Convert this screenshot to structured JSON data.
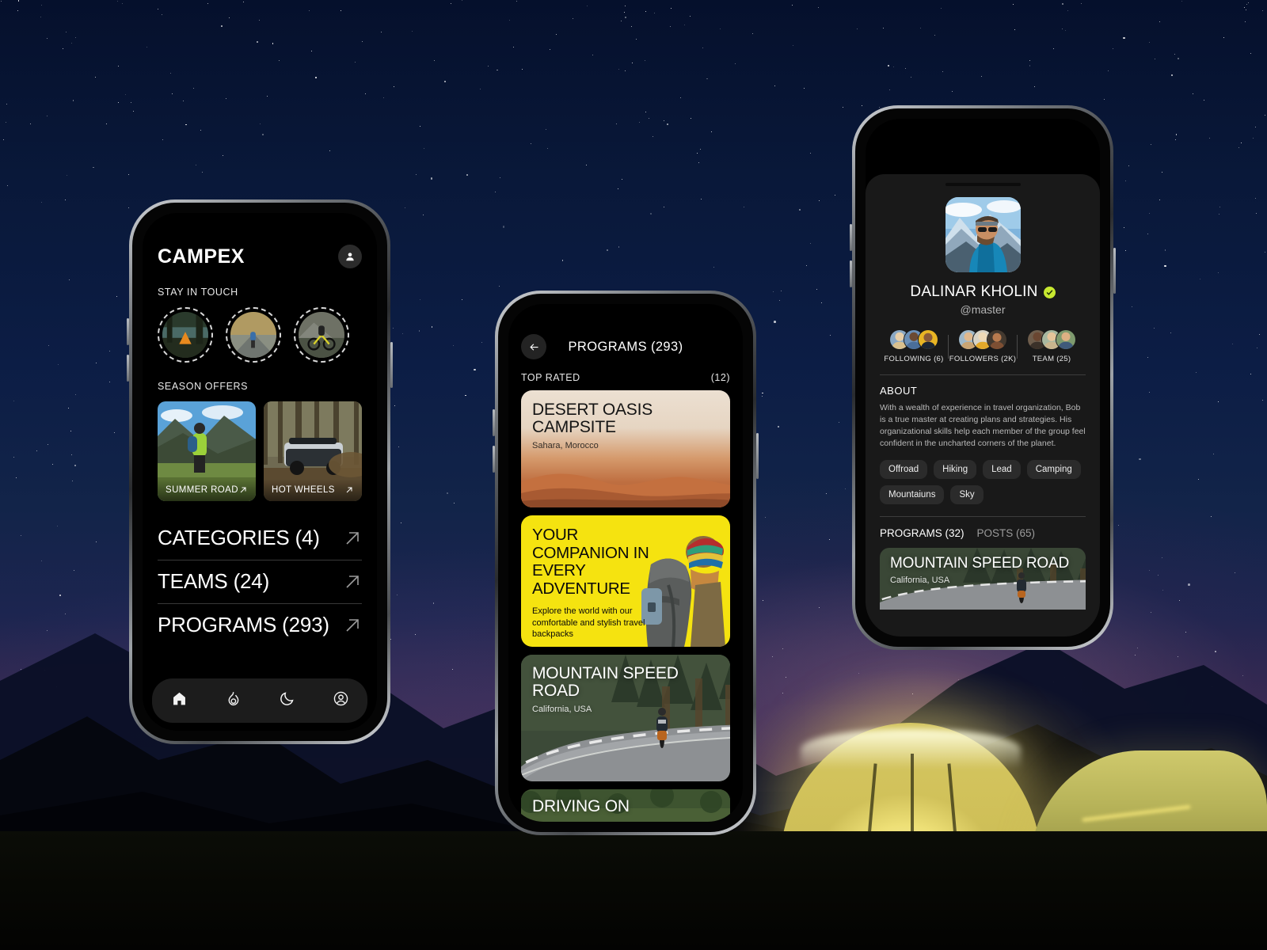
{
  "background": {
    "scene": "night-sky-mountains-camping-tents",
    "sky_color": "#0c1d45",
    "horizon_glow": "#4e3052",
    "tent_glow": "#f4ec9e"
  },
  "phone1": {
    "brand": "CAMPEX",
    "profile_icon": "user-icon",
    "sections": {
      "stay_in_touch": "STAY IN TOUCH",
      "season_offers": "SEASON OFFERS"
    },
    "stories": [
      {
        "name": "story-tent-lake"
      },
      {
        "name": "story-cyclist-road"
      },
      {
        "name": "story-mountain-biker"
      },
      {
        "name": "story-tent-sunset"
      }
    ],
    "offers": [
      {
        "label": "SUMMER ROAD",
        "icon": "arrow-up-right-icon"
      },
      {
        "label": "HOT WHEELS",
        "icon": "arrow-up-right-icon"
      }
    ],
    "nav": [
      {
        "label": "CATEGORIES (4)",
        "icon": "arrow-up-right-icon"
      },
      {
        "label": "TEAMS (24)",
        "icon": "arrow-up-right-icon"
      },
      {
        "label": "PROGRAMS (293)",
        "icon": "arrow-up-right-icon"
      }
    ],
    "tabs": [
      {
        "name": "home-icon",
        "active": true
      },
      {
        "name": "flame-icon",
        "active": false
      },
      {
        "name": "moon-icon",
        "active": false
      },
      {
        "name": "user-circle-icon",
        "active": false
      }
    ]
  },
  "phone2": {
    "back_icon": "arrow-left-icon",
    "title": "PROGRAMS (293)",
    "section_label": "TOP RATED",
    "section_count": "(12)",
    "cards": [
      {
        "type": "desert",
        "title": "DESERT OASIS CAMPSITE",
        "location": "Sahara, Morocco"
      },
      {
        "type": "promo",
        "heading": "YOUR COMPANION IN EVERY ADVENTURE",
        "body": "Explore the world with our comfortable and stylish travel backpacks",
        "accent": "#f5e310"
      },
      {
        "type": "photo",
        "title": "MOUNTAIN SPEED ROAD",
        "location": "California, USA"
      },
      {
        "type": "photo-partial",
        "title": "DRIVING ON"
      }
    ]
  },
  "phone3": {
    "avatar": "profile-photo-mountaineer",
    "name": "DALINAR KHOLIN",
    "verified_icon": "verified-check-icon",
    "verified_color": "#c7e830",
    "handle": "@master",
    "stats": [
      {
        "label": "FOLLOWING (6)"
      },
      {
        "label": "FOLLOWERS (2K)"
      },
      {
        "label": "TEAM (25)"
      }
    ],
    "about_heading": "ABOUT",
    "about_text": "With a wealth of experience in travel organization, Bob is a true master at creating plans and strategies. His organizational skills help each member of the group feel confident in the uncharted corners of the planet.",
    "tags": [
      "Offroad",
      "Hiking",
      "Lead",
      "Camping",
      "Mountaiuns",
      "Sky"
    ],
    "tabs": [
      {
        "label": "PROGRAMS (32)",
        "active": true
      },
      {
        "label": "POSTS (65)",
        "active": false
      }
    ],
    "card": {
      "title": "MOUNTAIN SPEED ROAD",
      "location": "California, USA"
    }
  }
}
